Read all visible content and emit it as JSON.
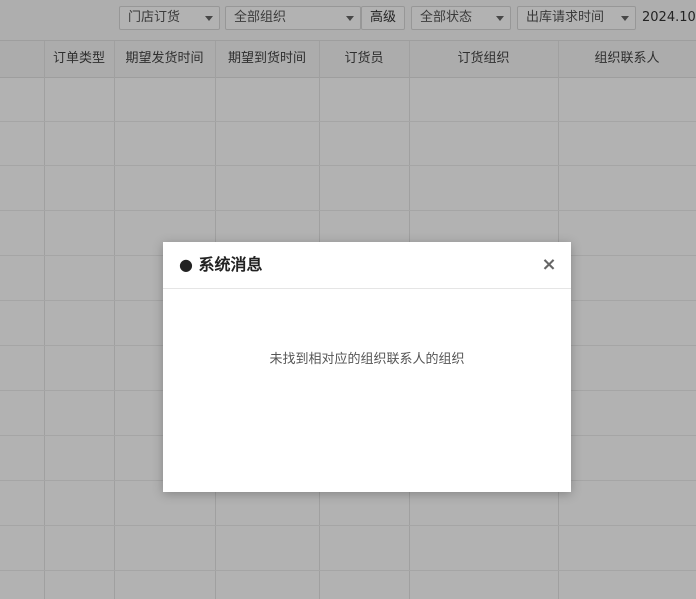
{
  "toolbar": {
    "store_order_select": "门店订货",
    "org_select": "全部组织",
    "advanced_button": "高级",
    "status_select": "全部状态",
    "time_field_select": "出库请求时间",
    "date_value": "2024.10."
  },
  "table": {
    "columns": [
      "订单类型",
      "期望发货时间",
      "期望到货时间",
      "订货员",
      "订货组织",
      "组织联系人"
    ]
  },
  "dialog": {
    "title": "● 系统消息",
    "close": "×",
    "message": "未找到相对应的组织联系人的组织"
  }
}
